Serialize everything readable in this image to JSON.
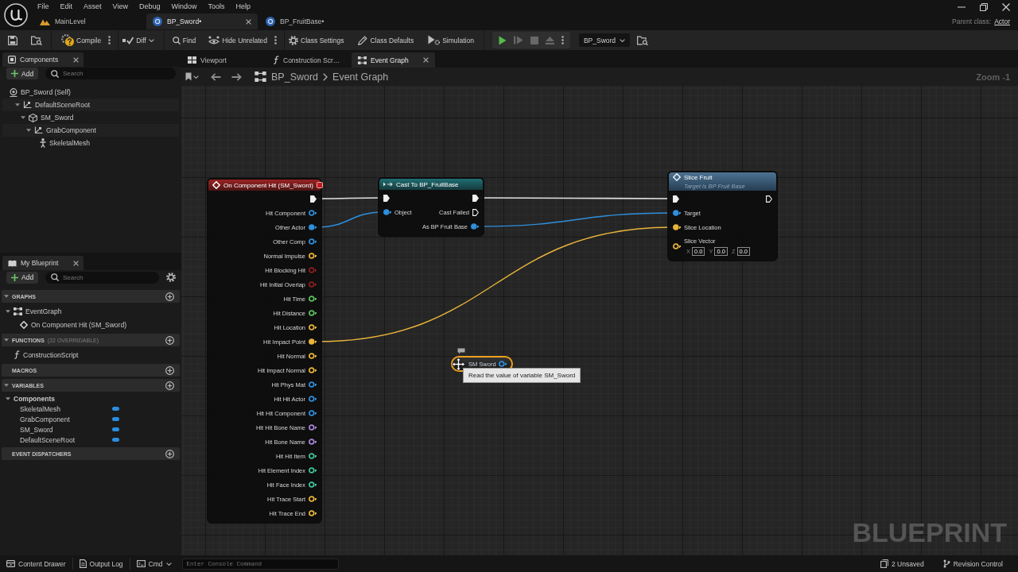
{
  "title_bar": {
    "menu": [
      "File",
      "Edit",
      "Asset",
      "View",
      "Debug",
      "Window",
      "Tools",
      "Help"
    ],
    "tabs": [
      {
        "label": "MainLevel",
        "kind": "level",
        "selected": false
      },
      {
        "label": "BP_Sword•",
        "kind": "blueprint",
        "selected": true
      },
      {
        "label": "BP_FruitBase•",
        "kind": "blueprint",
        "selected": false
      }
    ],
    "parent_class": {
      "label": "Parent class:",
      "value": "Actor"
    }
  },
  "toolbar": {
    "buttons": [
      {
        "label": "Compile",
        "kind": "compile"
      },
      {
        "label": "Diff",
        "kind": "diff"
      },
      {
        "label": "Find",
        "kind": "find"
      },
      {
        "label": "Hide Unrelated",
        "kind": "hide_unrelated"
      },
      {
        "label": "Class Settings",
        "kind": "class_settings"
      },
      {
        "label": "Class Defaults",
        "kind": "class_defaults"
      },
      {
        "label": "Simulation",
        "kind": "simulation"
      }
    ],
    "play_controls": [
      {
        "kind": "play",
        "disabled": false
      },
      {
        "kind": "step",
        "disabled": true
      },
      {
        "kind": "stop",
        "disabled": true
      },
      {
        "kind": "eject",
        "disabled": true
      }
    ],
    "debug_object": "BP_Sword"
  },
  "components_panel": {
    "title": "Components",
    "add_button": "Add",
    "search": {
      "placeholder": "Search"
    },
    "tree": [
      {
        "label": "BP_Sword (Self)",
        "kind": "self",
        "children": [
          {
            "label": "DefaultSceneRoot",
            "kind": "scene",
            "expanded": true,
            "children": [
              {
                "label": "SM_Sword",
                "kind": "static_mesh",
                "expanded": true,
                "children": [
                  {
                    "label": "GrabComponent",
                    "kind": "scene",
                    "expanded": true,
                    "children": [
                      {
                        "label": "SkeletalMesh",
                        "kind": "skeletal_mesh"
                      }
                    ]
                  }
                ]
              }
            ]
          }
        ]
      }
    ]
  },
  "my_blueprint": {
    "title": "My Blueprint",
    "add_button": "Add",
    "search": {
      "placeholder": "Search"
    },
    "sections": [
      {
        "title": "GRAPHS",
        "expanded": true,
        "items": [
          {
            "label": "EventGraph",
            "kind": "graph",
            "expanded": true,
            "children": [
              {
                "label": "On Component Hit (SM_Sword)",
                "kind": "event"
              }
            ]
          }
        ]
      },
      {
        "title": "FUNCTIONS",
        "note": "(22 OVERRIDABLE)",
        "expanded": true,
        "items": [
          {
            "label": "ConstructionScript",
            "kind": "function"
          }
        ]
      },
      {
        "title": "MACROS"
      },
      {
        "title": "VARIABLES",
        "expanded": true,
        "items": [
          {
            "label": "Components",
            "kind": "category",
            "expanded": true,
            "children": [
              {
                "label": "SkeletalMesh",
                "kind": "variable"
              },
              {
                "label": "GrabComponent",
                "kind": "variable"
              },
              {
                "label": "SM_Sword",
                "kind": "variable"
              },
              {
                "label": "DefaultSceneRoot",
                "kind": "variable"
              }
            ]
          }
        ]
      },
      {
        "title": "EVENT DISPATCHERS"
      }
    ]
  },
  "graph_editor": {
    "tabs": [
      {
        "label": "Viewport",
        "kind": "viewport",
        "selected": false
      },
      {
        "label": "Construction Scr…",
        "kind": "function",
        "selected": false
      },
      {
        "label": "Event Graph",
        "kind": "graph",
        "selected": true
      }
    ],
    "breadcrumb": [
      "BP_Sword",
      "Event Graph"
    ],
    "zoom": "Zoom -1",
    "graph_label": "BLUEPRINT",
    "nodes": [
      {
        "kind": "event",
        "title": "On Component Hit (SM_Sword)",
        "selected": false,
        "outputs": [
          {
            "kind": "exec",
            "connected": true
          },
          {
            "kind": "data",
            "label": "Hit Component",
            "color": "#2f8fdc",
            "connected": false
          },
          {
            "kind": "data",
            "label": "Other Actor",
            "color": "#2f8fdc",
            "connected": true
          },
          {
            "kind": "data",
            "label": "Other Comp",
            "color": "#2f8fdc",
            "connected": false
          },
          {
            "kind": "data",
            "label": "Normal Impulse",
            "color": "#e8b43a",
            "connected": false
          },
          {
            "kind": "data",
            "label": "Hit Blocking Hit",
            "color": "#8f1d1d",
            "connected": false
          },
          {
            "kind": "data",
            "label": "Hit Initial Overlap",
            "color": "#8f1d1d",
            "connected": false
          },
          {
            "kind": "data",
            "label": "Hit Time",
            "color": "#5cc15e",
            "connected": false
          },
          {
            "kind": "data",
            "label": "Hit Distance",
            "color": "#5cc15e",
            "connected": false
          },
          {
            "kind": "data",
            "label": "Hit Location",
            "color": "#e8b43a",
            "connected": false
          },
          {
            "kind": "data",
            "label": "Hit Impact Point",
            "color": "#e8b43a",
            "connected": true
          },
          {
            "kind": "data",
            "label": "Hit Normal",
            "color": "#e8b43a",
            "connected": false
          },
          {
            "kind": "data",
            "label": "Hit Impact Normal",
            "color": "#e8b43a",
            "connected": false
          },
          {
            "kind": "data",
            "label": "Hit Phys Mat",
            "color": "#2f8fdc",
            "connected": false
          },
          {
            "kind": "data",
            "label": "Hit Hit Actor",
            "color": "#2f8fdc",
            "connected": false
          },
          {
            "kind": "data",
            "label": "Hit Hit Component",
            "color": "#2f8fdc",
            "connected": false
          },
          {
            "kind": "data",
            "label": "Hit Hit Bone Name",
            "color": "#a985d8",
            "connected": false
          },
          {
            "kind": "data",
            "label": "Hit Bone Name",
            "color": "#a985d8",
            "connected": false
          },
          {
            "kind": "data",
            "label": "Hit Hit Item",
            "color": "#3fc49c",
            "connected": false
          },
          {
            "kind": "data",
            "label": "Hit Element Index",
            "color": "#3fc49c",
            "connected": false
          },
          {
            "kind": "data",
            "label": "Hit Face Index",
            "color": "#3fc49c",
            "connected": false
          },
          {
            "kind": "data",
            "label": "Hit Trace Start",
            "color": "#e8b43a",
            "connected": false
          },
          {
            "kind": "data",
            "label": "Hit Trace End",
            "color": "#e8b43a",
            "connected": false
          }
        ]
      },
      {
        "kind": "cast",
        "title": "Cast To BP_FruitBase",
        "selected": false,
        "inputs": [
          {
            "kind": "exec",
            "connected": true
          },
          {
            "kind": "data",
            "label": "Object",
            "color": "#2f8fdc",
            "connected": true
          }
        ],
        "outputs": [
          {
            "kind": "exec",
            "connected": true
          },
          {
            "kind": "exec",
            "label": "Cast Failed",
            "connected": false
          },
          {
            "kind": "data",
            "label": "As BP Fruit Base",
            "color": "#2f8fdc",
            "connected": true
          }
        ]
      },
      {
        "kind": "function",
        "title": "Slice Fruit",
        "subtitle": "Target is BP Fruit Base",
        "selected": false,
        "inputs": [
          {
            "kind": "exec",
            "connected": true
          },
          {
            "kind": "data",
            "label": "Target",
            "color": "#2f8fdc",
            "connected": true
          },
          {
            "kind": "data",
            "label": "Slice Location",
            "color": "#e8b43a",
            "connected": true
          },
          {
            "kind": "data",
            "label": "Slice Vector",
            "color": "#e8b43a",
            "connected": false,
            "fields": [
              {
                "axis": "X",
                "value": "0.0"
              },
              {
                "axis": "Y",
                "value": "0.0"
              },
              {
                "axis": "Z",
                "value": "0.0"
              }
            ]
          }
        ],
        "outputs": [
          {
            "kind": "exec",
            "connected": false
          }
        ]
      },
      {
        "kind": "variable",
        "title": "SM Sword",
        "selected": true,
        "outputs": [
          {
            "kind": "data",
            "color": "#2f8fdc",
            "connected": false
          }
        ]
      }
    ],
    "tooltip": "Read the value of variable SM_Sword"
  },
  "status_bar": {
    "buttons": [
      {
        "label": "Content Drawer",
        "kind": "drawer"
      },
      {
        "label": "Output Log",
        "kind": "log"
      },
      {
        "label": "Cmd",
        "kind": "cmd"
      }
    ],
    "console": {
      "placeholder": "Enter Console Command"
    },
    "right_buttons": [
      {
        "label": "2 Unsaved",
        "kind": "unsaved"
      },
      {
        "label": "Revision Control",
        "kind": "revision"
      }
    ]
  }
}
